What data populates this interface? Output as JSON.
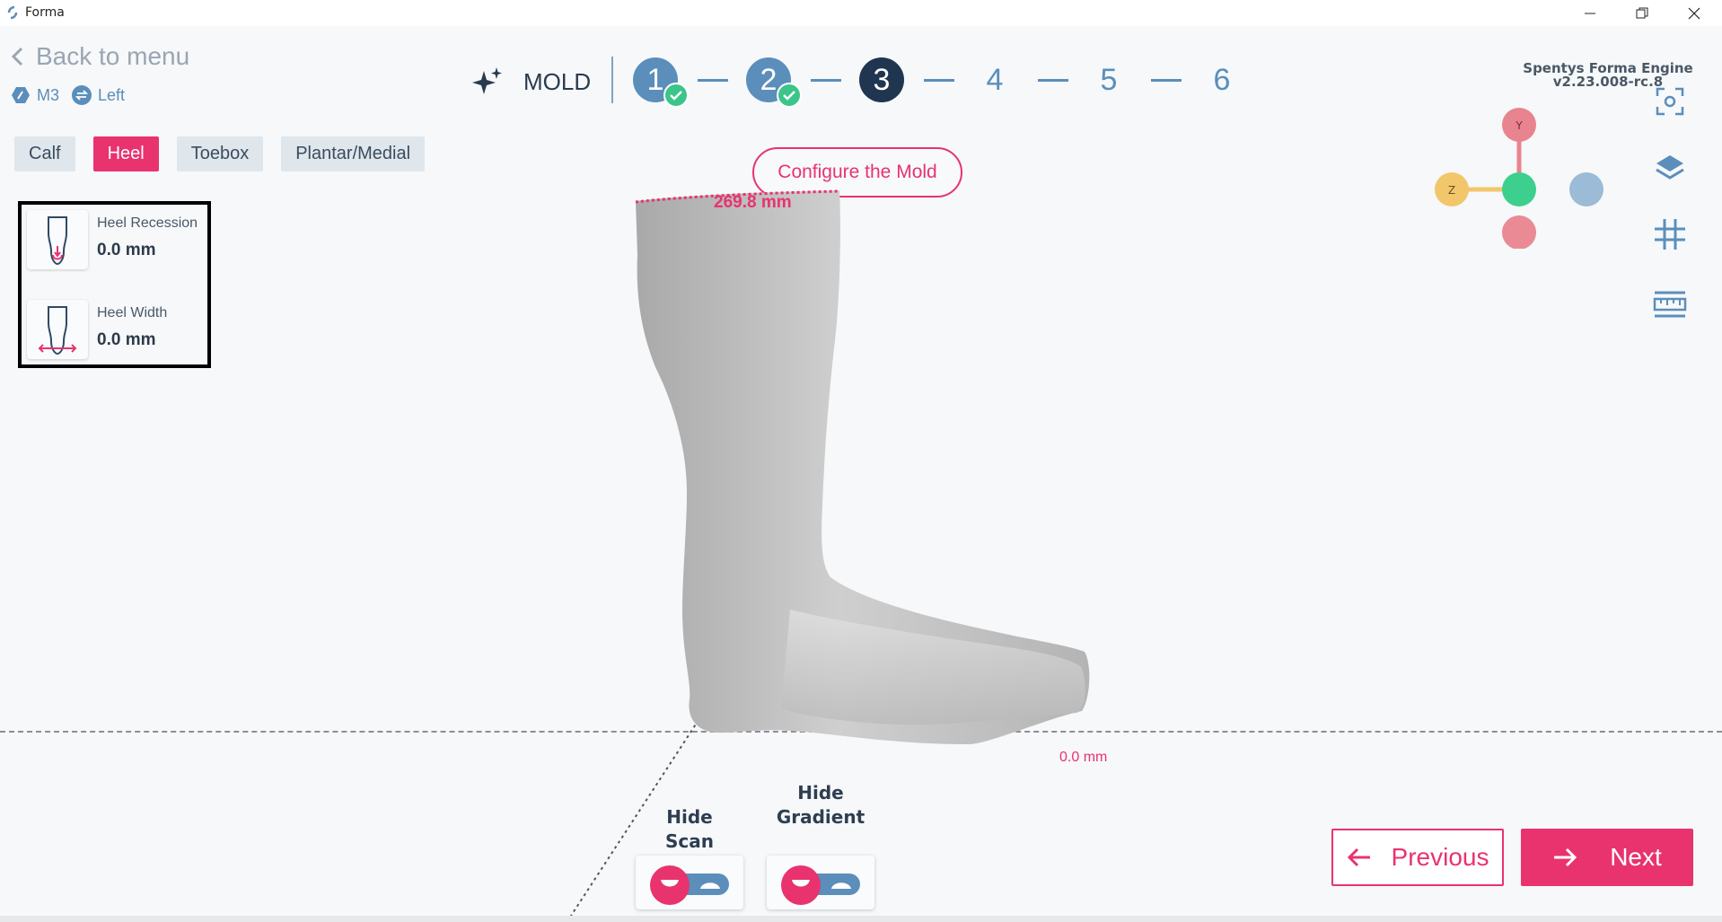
{
  "window": {
    "title": "Forma",
    "controls": {
      "minimize": "minimize-icon",
      "restore": "restore-icon",
      "close": "close-icon"
    }
  },
  "header": {
    "back_label": "Back to menu",
    "tags": [
      {
        "icon": "model-icon",
        "label": "M3"
      },
      {
        "icon": "swap-icon",
        "label": "Left"
      }
    ],
    "engine_version": "Spentys Forma Engine v2.23.008-rc.8"
  },
  "tabs": [
    {
      "label": "Calf",
      "active": false
    },
    {
      "label": "Heel",
      "active": true
    },
    {
      "label": "Toebox",
      "active": false
    },
    {
      "label": "Plantar/Medial",
      "active": false
    }
  ],
  "parameters": [
    {
      "label": "Heel Recession",
      "value": "0.0 mm",
      "icon": "heel-recession-icon"
    },
    {
      "label": "Heel Width",
      "value": "0.0 mm",
      "icon": "heel-width-icon"
    }
  ],
  "wizard": {
    "section_label": "MOLD",
    "section_icon": "sparkle-icon",
    "steps": [
      {
        "number": "1",
        "state": "done"
      },
      {
        "number": "2",
        "state": "done"
      },
      {
        "number": "3",
        "state": "current"
      },
      {
        "number": "4",
        "state": "todo"
      },
      {
        "number": "5",
        "state": "todo"
      },
      {
        "number": "6",
        "state": "todo"
      }
    ],
    "tooltip": "Configure the Mold"
  },
  "viewport": {
    "top_measure": "269.8 mm",
    "bottom_measure": "0.0 mm",
    "axis_labels": {
      "y": "Y",
      "z": "Z"
    },
    "axis_colors": {
      "y": "#e8848f",
      "z": "#f2c66b",
      "x": "#9bbbd6",
      "origin": "#3ccf8e",
      "neg": "#e8848f"
    }
  },
  "toolbar_icons": [
    "focus-icon",
    "layers-icon",
    "grid-icon",
    "ruler-icon"
  ],
  "toggles": [
    {
      "label": "Hide Scan"
    },
    {
      "label": "Hide Gradient"
    }
  ],
  "nav": {
    "previous": "Previous",
    "next": "Next"
  },
  "colors": {
    "accent": "#e8336f",
    "primary": "#5b8ebb",
    "dark": "#1f3550",
    "success": "#3cc48b"
  }
}
